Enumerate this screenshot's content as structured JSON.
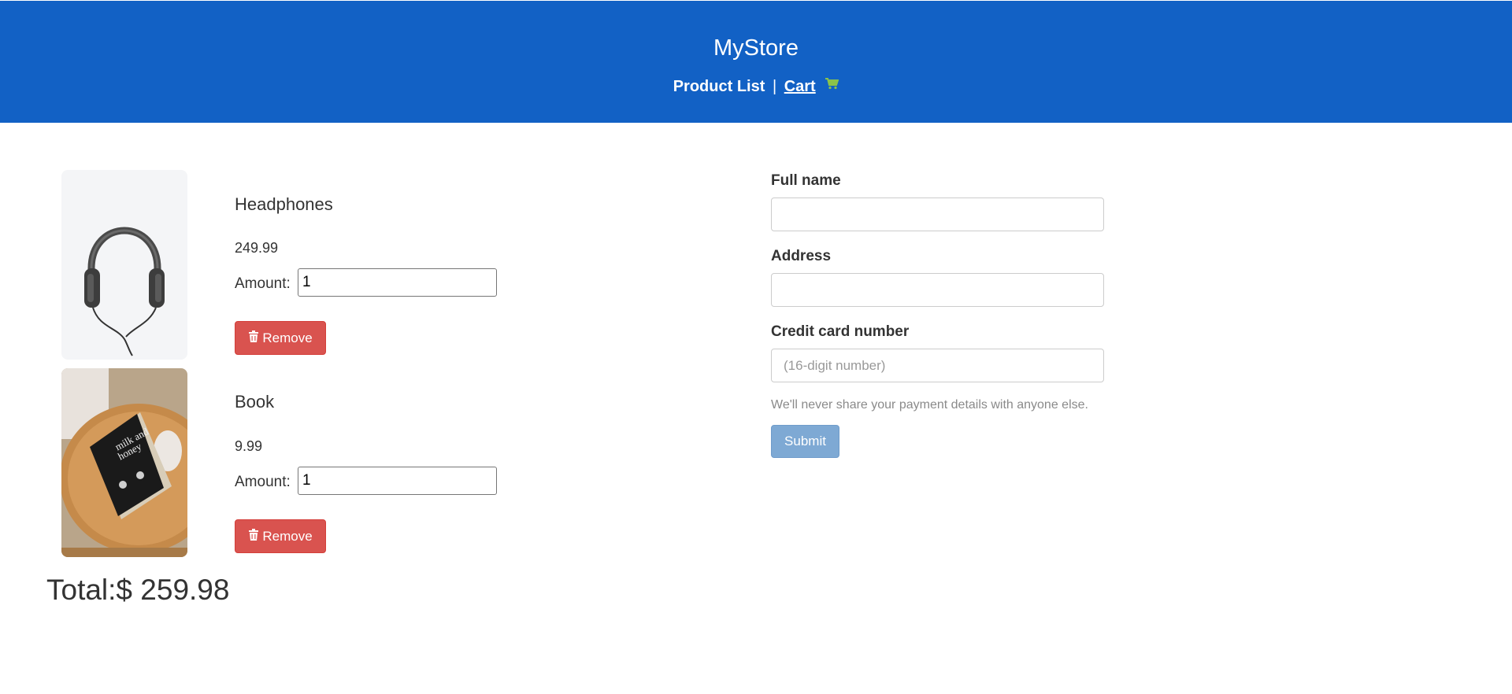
{
  "header": {
    "brand": "MyStore",
    "nav_product_list": "Product List",
    "nav_separator": "|",
    "nav_cart": "Cart",
    "background_color": "#1261c5",
    "cart_icon": "shopping-cart-icon",
    "cart_icon_color": "#8bc34a"
  },
  "cart": {
    "items": [
      {
        "name": "Headphones",
        "price": "249.99",
        "amount_label": "Amount:",
        "amount": "1",
        "remove_label": "Remove",
        "image": "headphones-image"
      },
      {
        "name": "Book",
        "price": "9.99",
        "amount_label": "Amount:",
        "amount": "1",
        "remove_label": "Remove",
        "image": "book-image"
      }
    ],
    "total": "Total:$ 259.98",
    "remove_icon": "trash-icon",
    "remove_color": "#d9534f"
  },
  "checkout": {
    "full_name_label": "Full name",
    "full_name_value": "",
    "address_label": "Address",
    "address_value": "",
    "card_label": "Credit card number",
    "card_placeholder": "(16-digit number)",
    "help_text": "We'll never share your payment details with anyone else.",
    "submit_label": "Submit",
    "submit_color": "#7ea9d4"
  }
}
